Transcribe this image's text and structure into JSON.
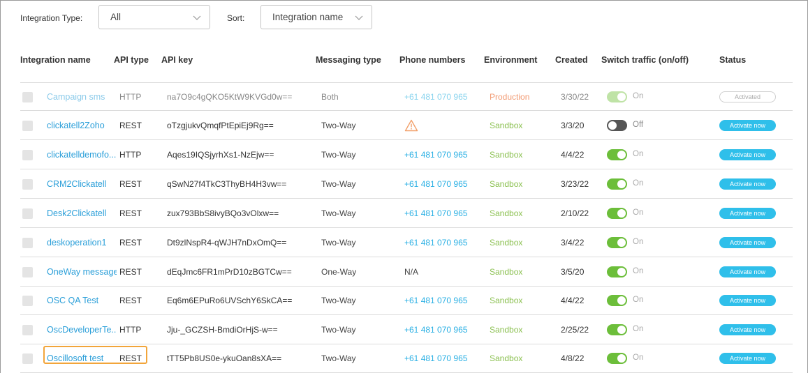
{
  "filters": {
    "type_label": "Integration Type:",
    "type_value": "All",
    "sort_label": "Sort:",
    "sort_value": "Integration name"
  },
  "columns": {
    "name": "Integration name",
    "api_type": "API type",
    "api_key": "API key",
    "messaging": "Messaging type",
    "phones": "Phone numbers",
    "environment": "Environment",
    "created": "Created",
    "switch": "Switch traffic (on/off)",
    "status": "Status"
  },
  "rows": [
    {
      "name": "Campaign sms",
      "api": "HTTP",
      "key": "na7O9c4gQKO5KtW9KVGd0w==",
      "messaging": "Both",
      "phone": "+61 481 070 965",
      "env": "Production",
      "created": "3/30/22",
      "toggle": "On",
      "status": "Activated"
    },
    {
      "name": "clickatell2Zoho",
      "api": "REST",
      "key": "oTzgjukvQmqfPtEpiEj9Rg==",
      "messaging": "Two-Way",
      "phone": "",
      "env": "Sandbox",
      "created": "3/3/20",
      "toggle": "Off",
      "status": "Activate now"
    },
    {
      "name": "clickatelldemofo...",
      "api": "HTTP",
      "key": "Aqes19IQSjyrhXs1-NzEjw==",
      "messaging": "Two-Way",
      "phone": "+61 481 070 965",
      "env": "Sandbox",
      "created": "4/4/22",
      "toggle": "On",
      "status": "Activate now"
    },
    {
      "name": "CRM2Clickatell",
      "api": "REST",
      "key": "qSwN27f4TkC3ThyBH4H3vw==",
      "messaging": "Two-Way",
      "phone": "+61 481 070 965",
      "env": "Sandbox",
      "created": "3/23/22",
      "toggle": "On",
      "status": "Activate now"
    },
    {
      "name": "Desk2Clickatell",
      "api": "REST",
      "key": "zux793BbS8ivyBQo3vOlxw==",
      "messaging": "Two-Way",
      "phone": "+61 481 070 965",
      "env": "Sandbox",
      "created": "2/10/22",
      "toggle": "On",
      "status": "Activate now"
    },
    {
      "name": "deskoperation1",
      "api": "REST",
      "key": "Dt9zlNspR4-qWJH7nDxOmQ==",
      "messaging": "Two-Way",
      "phone": "+61 481 070 965",
      "env": "Sandbox",
      "created": "3/4/22",
      "toggle": "On",
      "status": "Activate now"
    },
    {
      "name": "OneWay message",
      "api": "REST",
      "key": "dEqJmc6FR1mPrD10zBGTCw==",
      "messaging": "One-Way",
      "phone": "N/A",
      "env": "Sandbox",
      "created": "3/5/20",
      "toggle": "On",
      "status": "Activate now"
    },
    {
      "name": "OSC QA Test",
      "api": "REST",
      "key": "Eq6m6EPuRo6UVSchY6SkCA==",
      "messaging": "Two-Way",
      "phone": "+61 481 070 965",
      "env": "Sandbox",
      "created": "4/4/22",
      "toggle": "On",
      "status": "Activate now"
    },
    {
      "name": "OscDeveloperTe...",
      "api": "HTTP",
      "key": "Jju-_GCZSH-BmdiOrHjS-w==",
      "messaging": "Two-Way",
      "phone": "+61 481 070 965",
      "env": "Sandbox",
      "created": "2/25/22",
      "toggle": "On",
      "status": "Activate now"
    },
    {
      "name": "Oscillosoft test",
      "api": "REST",
      "key": "tTT5Pb8US0e-ykuOan8sXA==",
      "messaging": "Two-Way",
      "phone": "+61 481 070 965",
      "env": "Sandbox",
      "created": "4/8/22",
      "toggle": "On",
      "status": "Activate now"
    }
  ],
  "colors": {
    "accent": "#2fbfea",
    "toggle_on": "#6cbe3a",
    "sandbox": "#8cc152",
    "production": "#f29a72",
    "highlight": "#f2a53a"
  }
}
